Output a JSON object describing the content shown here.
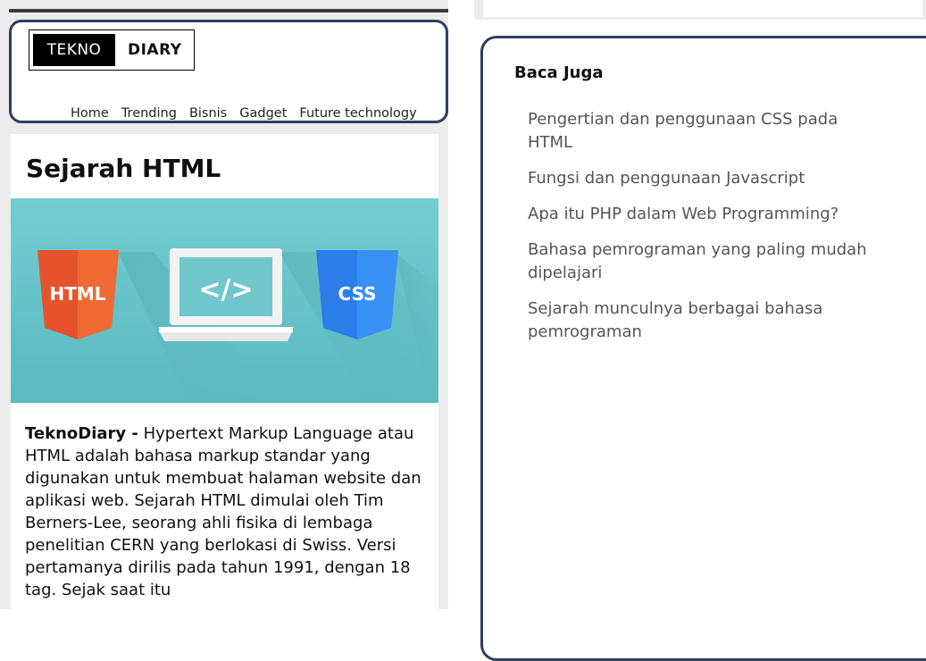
{
  "logo": {
    "dark_text": "TEKNO",
    "light_text": "DIARY"
  },
  "nav": {
    "items": [
      "Home",
      "Trending",
      "Bisnis",
      "Gadget",
      "Future technology"
    ]
  },
  "article": {
    "title": "Sejarah HTML",
    "hero": {
      "html_label": "HTML",
      "code_label": "</>",
      "css_label": "CSS"
    },
    "body_lead": "TeknoDiary -",
    "body_text": " Hypertext Markup Language atau HTML adalah bahasa markup standar yang digunakan untuk membuat halaman website dan aplikasi web. Sejarah HTML dimulai oleh Tim Berners-Lee, seorang ahli fisika di lembaga penelitian CERN yang berlokasi di Swiss. Versi pertamanya dirilis pada tahun 1991, dengan 18 tag. Sejak saat itu"
  },
  "sidebar": {
    "heading": "Baca Juga",
    "links": [
      "Pengertian dan penggunaan CSS pada HTML",
      "Fungsi dan penggunaan Javascript",
      "Apa itu PHP dalam Web Programming?",
      "Bahasa pemrograman yang paling mudah dipelajari",
      "Sejarah munculnya berbagai bahasa pemrograman"
    ]
  },
  "colors": {
    "frame_border": "#2f3e5c",
    "panel_bg": "#ececec",
    "hero_bg": "#66c2c7",
    "html_shield": "#e5532d",
    "css_shield": "#2b7de9",
    "link_text": "#555555"
  }
}
